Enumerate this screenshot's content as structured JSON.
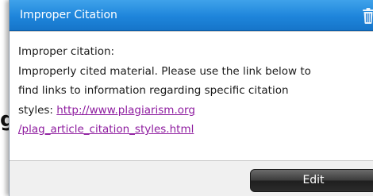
{
  "background": {
    "fragment_text": "g"
  },
  "popup": {
    "title": "Improper Citation",
    "header_icon": "trash-icon",
    "body": {
      "heading": "Improper citation:",
      "line1": "Improperly cited material. Please use the link below to",
      "line2": "find links to information regarding specific citation",
      "line3_prefix": "styles: ",
      "link_part1": "http://www.plagiarism.org",
      "link_part2": "/plag_article_citation_styles.html"
    },
    "edit_label": "Edit"
  },
  "colors": {
    "header": "#1e85db",
    "link": "#8e1c9f",
    "button": "#2b2b2b"
  }
}
